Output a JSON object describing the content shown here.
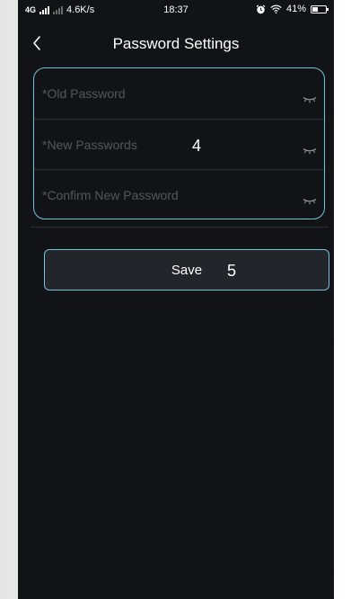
{
  "status_bar": {
    "network": "4G",
    "speed": "4.6K/s",
    "time": "18:37",
    "battery": "41%",
    "battery_level": 0.41,
    "icons": [
      "signal-icon",
      "alarm-icon",
      "wifi-icon",
      "battery-icon"
    ]
  },
  "header": {
    "title": "Password Settings",
    "back_icon": "chevron-left-icon"
  },
  "form": {
    "old_password_placeholder": "*Old Password",
    "new_password_placeholder": "*New Passwords",
    "confirm_password_placeholder": "*Confirm New Password",
    "eye_icon": "eye-closed-icon",
    "annotation": "4"
  },
  "save": {
    "label": "Save",
    "annotation": "5"
  },
  "colors": {
    "accent": "#6fc4d8",
    "background": "#121317",
    "button_bg": "#22252a",
    "placeholder": "#53575d"
  }
}
